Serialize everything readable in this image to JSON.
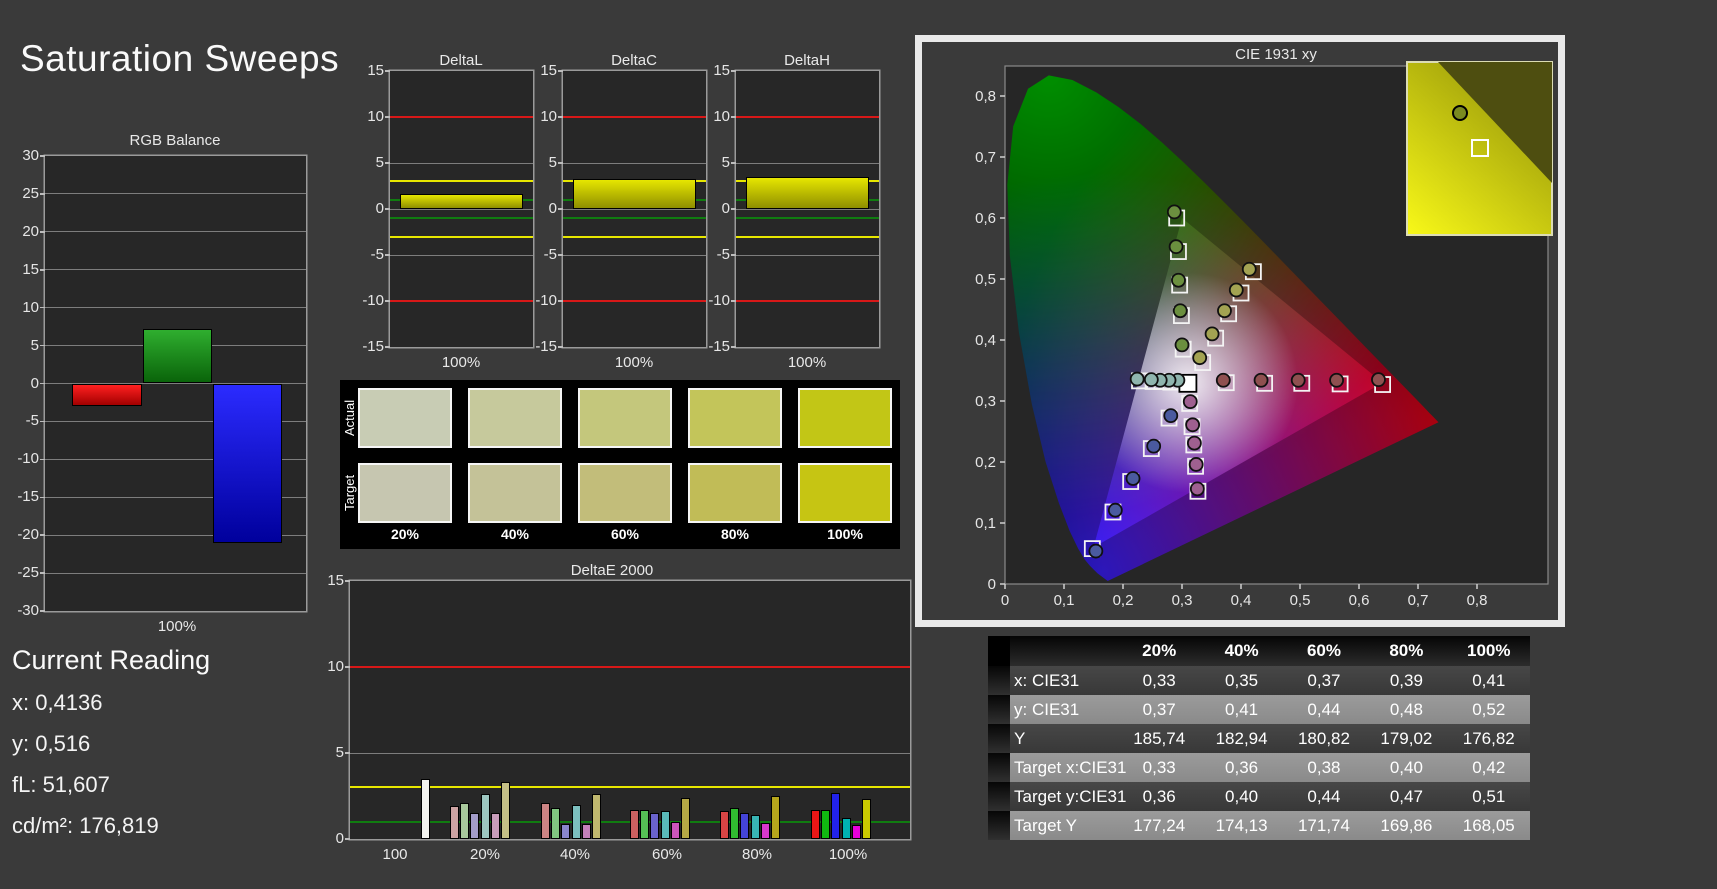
{
  "title": "Saturation Sweeps",
  "current_reading": {
    "heading": "Current Reading",
    "lines": [
      "x: 0,4136",
      "y: 0,516",
      "fL: 51,607",
      "cd/m²: 176,819"
    ]
  },
  "swatch_panel": {
    "row_labels": [
      "Actual",
      "Target"
    ],
    "levels": [
      "20%",
      "40%",
      "60%",
      "80%",
      "100%"
    ],
    "actual_colors": [
      "#c8ccb4",
      "#c6c99c",
      "#c4c77c",
      "#c3c55a",
      "#c2c616"
    ],
    "target_colors": [
      "#c6c6b0",
      "#c4c298",
      "#c2bd7a",
      "#c1bc57",
      "#c6c513"
    ]
  },
  "table": {
    "header": [
      "",
      "20%",
      "40%",
      "60%",
      "80%",
      "100%"
    ],
    "rows": [
      {
        "label": "x: CIE31",
        "shade": "dark",
        "values": [
          "0,33",
          "0,35",
          "0,37",
          "0,39",
          "0,41"
        ]
      },
      {
        "label": "y: CIE31",
        "shade": "light",
        "values": [
          "0,37",
          "0,41",
          "0,44",
          "0,48",
          "0,52"
        ]
      },
      {
        "label": "Y",
        "shade": "dark",
        "values": [
          "185,74",
          "182,94",
          "180,82",
          "179,02",
          "176,82"
        ]
      },
      {
        "label": "Target x:CIE31",
        "shade": "light",
        "values": [
          "0,33",
          "0,36",
          "0,38",
          "0,40",
          "0,42"
        ]
      },
      {
        "label": "Target y:CIE31",
        "shade": "dark",
        "values": [
          "0,36",
          "0,40",
          "0,44",
          "0,47",
          "0,51"
        ]
      },
      {
        "label": "Target Y",
        "shade": "light",
        "values": [
          "177,24",
          "174,13",
          "171,74",
          "169,86",
          "168,05"
        ]
      }
    ]
  },
  "chart_data": [
    {
      "id": "rgb_balance",
      "type": "bar",
      "title": "RGB Balance",
      "categories": [
        "Red",
        "Green",
        "Blue"
      ],
      "values": [
        -3,
        7.2,
        -21
      ],
      "bar_colors": [
        [
          "#ff2020",
          "#a30000"
        ],
        [
          "#2fae2f",
          "#0a640a"
        ],
        [
          "#2b2bff",
          "#00009c"
        ]
      ],
      "xlabel": "100%",
      "ylim": [
        -30,
        30
      ],
      "ystep": 5
    },
    {
      "id": "deltaL",
      "type": "bar",
      "title": "DeltaL",
      "categories": [
        "100%"
      ],
      "values": [
        1.6
      ],
      "bar_colors": [
        [
          "#e6e600",
          "#8f8f00"
        ]
      ],
      "xlabel": "100%",
      "ylim": [
        -15,
        15
      ],
      "ystep": 5,
      "ref_lines": [
        {
          "value": 10,
          "color": "#d81818"
        },
        {
          "value": -10,
          "color": "#d81818"
        },
        {
          "value": 3,
          "color": "#e8e800"
        },
        {
          "value": -3,
          "color": "#e8e800"
        },
        {
          "value": 1,
          "color": "#107c10"
        },
        {
          "value": -1,
          "color": "#107c10"
        }
      ]
    },
    {
      "id": "deltaC",
      "type": "bar",
      "title": "DeltaC",
      "categories": [
        "100%"
      ],
      "values": [
        3.3
      ],
      "bar_colors": [
        [
          "#e6e600",
          "#8f8f00"
        ]
      ],
      "xlabel": "100%",
      "ylim": [
        -15,
        15
      ],
      "ystep": 5,
      "ref_lines": [
        {
          "value": 10,
          "color": "#d81818"
        },
        {
          "value": -10,
          "color": "#d81818"
        },
        {
          "value": 3,
          "color": "#e8e800"
        },
        {
          "value": -3,
          "color": "#e8e800"
        },
        {
          "value": 1,
          "color": "#107c10"
        },
        {
          "value": -1,
          "color": "#107c10"
        }
      ]
    },
    {
      "id": "deltaH",
      "type": "bar",
      "title": "DeltaH",
      "categories": [
        "100%"
      ],
      "values": [
        3.5
      ],
      "bar_colors": [
        [
          "#e6e600",
          "#8f8f00"
        ]
      ],
      "xlabel": "100%",
      "ylim": [
        -15,
        15
      ],
      "ystep": 5,
      "ref_lines": [
        {
          "value": 10,
          "color": "#d81818"
        },
        {
          "value": -10,
          "color": "#d81818"
        },
        {
          "value": 3,
          "color": "#e8e800"
        },
        {
          "value": -3,
          "color": "#e8e800"
        },
        {
          "value": 1,
          "color": "#107c10"
        },
        {
          "value": -1,
          "color": "#107c10"
        }
      ]
    },
    {
      "id": "deltae2000",
      "type": "grouped_bar",
      "title": "DeltaE 2000",
      "ylim": [
        0,
        15
      ],
      "ystep": 5,
      "ref_lines": [
        {
          "value": 10,
          "color": "#d81818"
        },
        {
          "value": 3,
          "color": "#e8e800"
        },
        {
          "value": 1,
          "color": "#107c10"
        }
      ],
      "groups": [
        {
          "label": "100",
          "bars": [
            {
              "color": "#f2f2ee",
              "value": 3.5
            }
          ]
        },
        {
          "label": "20%",
          "bars": [
            {
              "color": "#cda3a3",
              "value": 1.9
            },
            {
              "color": "#a8c89c",
              "value": 2.1
            },
            {
              "color": "#a39cc9",
              "value": 1.5
            },
            {
              "color": "#9cc6c0",
              "value": 2.6
            },
            {
              "color": "#c89cba",
              "value": 1.5
            },
            {
              "color": "#c4bf86",
              "value": 3.3
            }
          ]
        },
        {
          "label": "40%",
          "bars": [
            {
              "color": "#cc8484",
              "value": 2.1
            },
            {
              "color": "#80c680",
              "value": 1.8
            },
            {
              "color": "#8a86cc",
              "value": 0.9
            },
            {
              "color": "#7cbfbf",
              "value": 2.0
            },
            {
              "color": "#c480ba",
              "value": 0.9
            },
            {
              "color": "#bfb76e",
              "value": 2.6
            }
          ]
        },
        {
          "label": "60%",
          "bars": [
            {
              "color": "#cc6060",
              "value": 1.7
            },
            {
              "color": "#55c055",
              "value": 1.7
            },
            {
              "color": "#6a63cc",
              "value": 1.5
            },
            {
              "color": "#59b9b9",
              "value": 1.6
            },
            {
              "color": "#cc55bb",
              "value": 1.0
            },
            {
              "color": "#b5a845",
              "value": 2.4
            }
          ]
        },
        {
          "label": "80%",
          "bars": [
            {
              "color": "#d84444",
              "value": 1.6
            },
            {
              "color": "#30bc30",
              "value": 1.8
            },
            {
              "color": "#4444d8",
              "value": 1.5
            },
            {
              "color": "#38b4b4",
              "value": 1.4
            },
            {
              "color": "#d838cc",
              "value": 0.95
            },
            {
              "color": "#b6a61c",
              "value": 2.5
            }
          ]
        },
        {
          "label": "100%",
          "bars": [
            {
              "color": "#ea1616",
              "value": 1.7
            },
            {
              "color": "#10b810",
              "value": 1.7
            },
            {
              "color": "#2222ea",
              "value": 2.7
            },
            {
              "color": "#00b2b2",
              "value": 1.2
            },
            {
              "color": "#e800dc",
              "value": 0.8
            },
            {
              "color": "#caca00",
              "value": 2.3
            }
          ]
        }
      ]
    },
    {
      "id": "cie",
      "type": "scatter",
      "title": "CIE 1931 xy",
      "xlim": [
        0,
        0.8
      ],
      "ylim": [
        0,
        0.8
      ],
      "tick_step": 0.1,
      "white_point": {
        "x": 0.31,
        "y": 0.329
      },
      "sweeps": [
        {
          "name": "red",
          "marker_fill": "#8f5050",
          "targets": [
            [
              0.375,
              0.33
            ],
            [
              0.44,
              0.329
            ],
            [
              0.503,
              0.329
            ],
            [
              0.568,
              0.328
            ],
            [
              0.64,
              0.327
            ]
          ],
          "measured": [
            [
              0.37,
              0.334
            ],
            [
              0.434,
              0.334
            ],
            [
              0.497,
              0.334
            ],
            [
              0.562,
              0.334
            ],
            [
              0.633,
              0.335
            ]
          ]
        },
        {
          "name": "green",
          "marker_fill": "#6b8f3f",
          "targets": [
            [
              0.302,
              0.385
            ],
            [
              0.299,
              0.44
            ],
            [
              0.296,
              0.49
            ],
            [
              0.294,
              0.545
            ],
            [
              0.291,
              0.6
            ]
          ],
          "measured": [
            [
              0.3,
              0.392
            ],
            [
              0.297,
              0.448
            ],
            [
              0.294,
              0.498
            ],
            [
              0.29,
              0.553
            ],
            [
              0.287,
              0.61
            ]
          ]
        },
        {
          "name": "blue",
          "marker_fill": "#4a5a9f",
          "targets": [
            [
              0.278,
              0.272
            ],
            [
              0.248,
              0.222
            ],
            [
              0.213,
              0.168
            ],
            [
              0.183,
              0.118
            ],
            [
              0.148,
              0.058
            ]
          ],
          "measured": [
            [
              0.281,
              0.276
            ],
            [
              0.252,
              0.226
            ],
            [
              0.217,
              0.173
            ],
            [
              0.187,
              0.121
            ],
            [
              0.154,
              0.054
            ]
          ]
        },
        {
          "name": "cyan",
          "marker_fill": "#8fb5ae",
          "targets": [
            [
              0.296,
              0.331
            ],
            [
              0.281,
              0.331
            ],
            [
              0.266,
              0.332
            ],
            [
              0.251,
              0.332
            ],
            [
              0.228,
              0.333
            ]
          ],
          "measured": [
            [
              0.293,
              0.334
            ],
            [
              0.278,
              0.334
            ],
            [
              0.263,
              0.334
            ],
            [
              0.248,
              0.335
            ],
            [
              0.224,
              0.336
            ]
          ]
        },
        {
          "name": "magenta",
          "marker_fill": "#9f6090",
          "targets": [
            [
              0.313,
              0.296
            ],
            [
              0.317,
              0.258
            ],
            [
              0.32,
              0.228
            ],
            [
              0.323,
              0.193
            ],
            [
              0.327,
              0.152
            ]
          ],
          "measured": [
            [
              0.314,
              0.299
            ],
            [
              0.318,
              0.261
            ],
            [
              0.321,
              0.231
            ],
            [
              0.324,
              0.196
            ],
            [
              0.326,
              0.156
            ]
          ]
        },
        {
          "name": "yellow",
          "marker_fill": "#a3a352",
          "targets": [
            [
              0.335,
              0.363
            ],
            [
              0.357,
              0.403
            ],
            [
              0.379,
              0.443
            ],
            [
              0.4,
              0.477
            ],
            [
              0.421,
              0.512
            ]
          ],
          "measured": [
            [
              0.33,
              0.371
            ],
            [
              0.351,
              0.41
            ],
            [
              0.372,
              0.448
            ],
            [
              0.392,
              0.482
            ],
            [
              0.414,
              0.516
            ]
          ]
        }
      ]
    }
  ]
}
